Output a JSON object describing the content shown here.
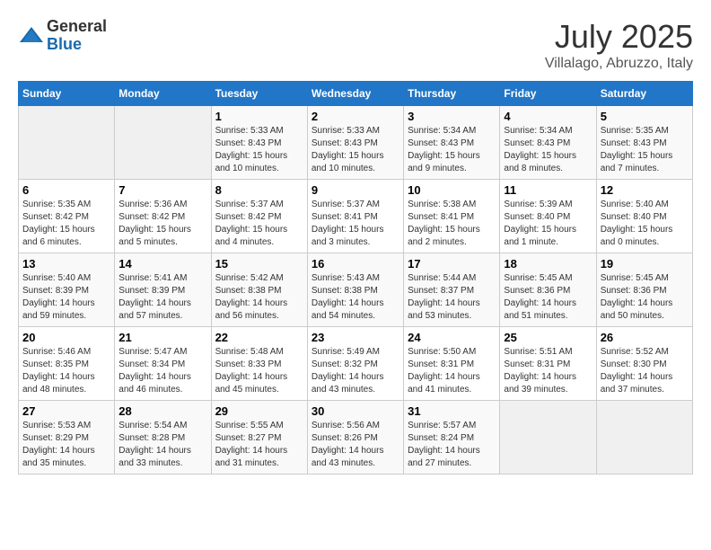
{
  "logo": {
    "general": "General",
    "blue": "Blue"
  },
  "title": "July 2025",
  "location": "Villalago, Abruzzo, Italy",
  "days_of_week": [
    "Sunday",
    "Monday",
    "Tuesday",
    "Wednesday",
    "Thursday",
    "Friday",
    "Saturday"
  ],
  "weeks": [
    [
      {
        "day": "",
        "empty": true
      },
      {
        "day": "",
        "empty": true
      },
      {
        "day": "1",
        "sunrise": "Sunrise: 5:33 AM",
        "sunset": "Sunset: 8:43 PM",
        "daylight": "Daylight: 15 hours and 10 minutes."
      },
      {
        "day": "2",
        "sunrise": "Sunrise: 5:33 AM",
        "sunset": "Sunset: 8:43 PM",
        "daylight": "Daylight: 15 hours and 10 minutes."
      },
      {
        "day": "3",
        "sunrise": "Sunrise: 5:34 AM",
        "sunset": "Sunset: 8:43 PM",
        "daylight": "Daylight: 15 hours and 9 minutes."
      },
      {
        "day": "4",
        "sunrise": "Sunrise: 5:34 AM",
        "sunset": "Sunset: 8:43 PM",
        "daylight": "Daylight: 15 hours and 8 minutes."
      },
      {
        "day": "5",
        "sunrise": "Sunrise: 5:35 AM",
        "sunset": "Sunset: 8:43 PM",
        "daylight": "Daylight: 15 hours and 7 minutes."
      }
    ],
    [
      {
        "day": "6",
        "sunrise": "Sunrise: 5:35 AM",
        "sunset": "Sunset: 8:42 PM",
        "daylight": "Daylight: 15 hours and 6 minutes."
      },
      {
        "day": "7",
        "sunrise": "Sunrise: 5:36 AM",
        "sunset": "Sunset: 8:42 PM",
        "daylight": "Daylight: 15 hours and 5 minutes."
      },
      {
        "day": "8",
        "sunrise": "Sunrise: 5:37 AM",
        "sunset": "Sunset: 8:42 PM",
        "daylight": "Daylight: 15 hours and 4 minutes."
      },
      {
        "day": "9",
        "sunrise": "Sunrise: 5:37 AM",
        "sunset": "Sunset: 8:41 PM",
        "daylight": "Daylight: 15 hours and 3 minutes."
      },
      {
        "day": "10",
        "sunrise": "Sunrise: 5:38 AM",
        "sunset": "Sunset: 8:41 PM",
        "daylight": "Daylight: 15 hours and 2 minutes."
      },
      {
        "day": "11",
        "sunrise": "Sunrise: 5:39 AM",
        "sunset": "Sunset: 8:40 PM",
        "daylight": "Daylight: 15 hours and 1 minute."
      },
      {
        "day": "12",
        "sunrise": "Sunrise: 5:40 AM",
        "sunset": "Sunset: 8:40 PM",
        "daylight": "Daylight: 15 hours and 0 minutes."
      }
    ],
    [
      {
        "day": "13",
        "sunrise": "Sunrise: 5:40 AM",
        "sunset": "Sunset: 8:39 PM",
        "daylight": "Daylight: 14 hours and 59 minutes."
      },
      {
        "day": "14",
        "sunrise": "Sunrise: 5:41 AM",
        "sunset": "Sunset: 8:39 PM",
        "daylight": "Daylight: 14 hours and 57 minutes."
      },
      {
        "day": "15",
        "sunrise": "Sunrise: 5:42 AM",
        "sunset": "Sunset: 8:38 PM",
        "daylight": "Daylight: 14 hours and 56 minutes."
      },
      {
        "day": "16",
        "sunrise": "Sunrise: 5:43 AM",
        "sunset": "Sunset: 8:38 PM",
        "daylight": "Daylight: 14 hours and 54 minutes."
      },
      {
        "day": "17",
        "sunrise": "Sunrise: 5:44 AM",
        "sunset": "Sunset: 8:37 PM",
        "daylight": "Daylight: 14 hours and 53 minutes."
      },
      {
        "day": "18",
        "sunrise": "Sunrise: 5:45 AM",
        "sunset": "Sunset: 8:36 PM",
        "daylight": "Daylight: 14 hours and 51 minutes."
      },
      {
        "day": "19",
        "sunrise": "Sunrise: 5:45 AM",
        "sunset": "Sunset: 8:36 PM",
        "daylight": "Daylight: 14 hours and 50 minutes."
      }
    ],
    [
      {
        "day": "20",
        "sunrise": "Sunrise: 5:46 AM",
        "sunset": "Sunset: 8:35 PM",
        "daylight": "Daylight: 14 hours and 48 minutes."
      },
      {
        "day": "21",
        "sunrise": "Sunrise: 5:47 AM",
        "sunset": "Sunset: 8:34 PM",
        "daylight": "Daylight: 14 hours and 46 minutes."
      },
      {
        "day": "22",
        "sunrise": "Sunrise: 5:48 AM",
        "sunset": "Sunset: 8:33 PM",
        "daylight": "Daylight: 14 hours and 45 minutes."
      },
      {
        "day": "23",
        "sunrise": "Sunrise: 5:49 AM",
        "sunset": "Sunset: 8:32 PM",
        "daylight": "Daylight: 14 hours and 43 minutes."
      },
      {
        "day": "24",
        "sunrise": "Sunrise: 5:50 AM",
        "sunset": "Sunset: 8:31 PM",
        "daylight": "Daylight: 14 hours and 41 minutes."
      },
      {
        "day": "25",
        "sunrise": "Sunrise: 5:51 AM",
        "sunset": "Sunset: 8:31 PM",
        "daylight": "Daylight: 14 hours and 39 minutes."
      },
      {
        "day": "26",
        "sunrise": "Sunrise: 5:52 AM",
        "sunset": "Sunset: 8:30 PM",
        "daylight": "Daylight: 14 hours and 37 minutes."
      }
    ],
    [
      {
        "day": "27",
        "sunrise": "Sunrise: 5:53 AM",
        "sunset": "Sunset: 8:29 PM",
        "daylight": "Daylight: 14 hours and 35 minutes."
      },
      {
        "day": "28",
        "sunrise": "Sunrise: 5:54 AM",
        "sunset": "Sunset: 8:28 PM",
        "daylight": "Daylight: 14 hours and 33 minutes."
      },
      {
        "day": "29",
        "sunrise": "Sunrise: 5:55 AM",
        "sunset": "Sunset: 8:27 PM",
        "daylight": "Daylight: 14 hours and 31 minutes."
      },
      {
        "day": "30",
        "sunrise": "Sunrise: 5:56 AM",
        "sunset": "Sunset: 8:26 PM",
        "daylight": "Daylight: 14 hours and 43 minutes."
      },
      {
        "day": "31",
        "sunrise": "Sunrise: 5:57 AM",
        "sunset": "Sunset: 8:24 PM",
        "daylight": "Daylight: 14 hours and 27 minutes."
      },
      {
        "day": "",
        "empty": true
      },
      {
        "day": "",
        "empty": true
      }
    ]
  ]
}
